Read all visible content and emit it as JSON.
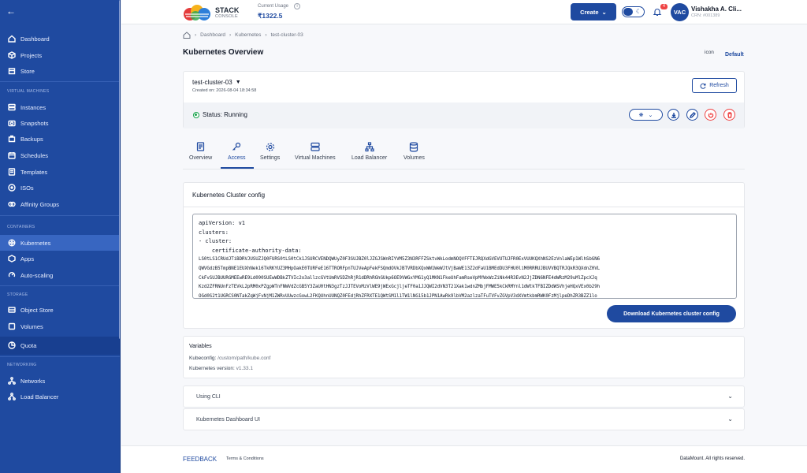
{
  "sidebar": {
    "back_icon": "arrow-left-icon",
    "items_top": [
      {
        "label": "Dashboard",
        "icon": "home-icon"
      },
      {
        "label": "Projects",
        "icon": "cube-icon"
      },
      {
        "label": "Store",
        "icon": "store-icon"
      }
    ],
    "section_vm": "VIRTUAL MACHINES",
    "items_vm": [
      {
        "label": "Instances",
        "icon": "server-icon"
      },
      {
        "label": "Snapshots",
        "icon": "snapshot-icon"
      },
      {
        "label": "Backups",
        "icon": "backup-icon"
      },
      {
        "label": "Schedules",
        "icon": "calendar-icon"
      },
      {
        "label": "Templates",
        "icon": "template-icon"
      },
      {
        "label": "ISOs",
        "icon": "disc-icon"
      },
      {
        "label": "Affinity Groups",
        "icon": "group-icon"
      }
    ],
    "section_containers": "CONTAINERS",
    "items_containers": [
      {
        "label": "Kubernetes",
        "icon": "kubernetes-icon",
        "active": true
      },
      {
        "label": "Apps",
        "icon": "apps-icon"
      },
      {
        "label": "Auto-scaling",
        "icon": "autoscale-icon"
      }
    ],
    "section_storage": "STORAGE",
    "items_storage": [
      {
        "label": "Object Store",
        "icon": "object-store-icon"
      },
      {
        "label": "Volumes",
        "icon": "volumes-icon"
      }
    ],
    "quota": {
      "label": "Quota",
      "icon": "quota-icon"
    },
    "section_networking": "NETWORKING",
    "items_networking": [
      {
        "label": "Networks",
        "icon": "network-icon"
      },
      {
        "label": "Load Balancer",
        "icon": "load-balancer-icon"
      }
    ]
  },
  "header": {
    "logo_text": "STACK",
    "logo_sub": "CONSOLE",
    "usage_label": "Current Usage",
    "usage_value": "₹1322.5",
    "create_label": "Create",
    "notification_count": "4",
    "avatar_initials": "VAC",
    "user_name": "Vishakha A. Cli...",
    "user_crn": "CRN: #001389"
  },
  "breadcrumb": {
    "items": [
      "Dashboard",
      "Kubernetes",
      "test-cluster-03"
    ]
  },
  "page": {
    "title": "Kubernetes Overview",
    "default_label": "Default",
    "broken_icon_alt": "icon"
  },
  "cluster": {
    "name": "test-cluster-03",
    "created": "Created on: 2026-08-04 18:34:58",
    "refresh_label": "Refresh",
    "status": "Status: Running",
    "status_color": "#16a34a"
  },
  "tabs": [
    {
      "label": "Overview",
      "icon": "overview-icon"
    },
    {
      "label": "Access",
      "icon": "key-icon",
      "active": true
    },
    {
      "label": "Settings",
      "icon": "gear-icon"
    },
    {
      "label": "Virtual Machines",
      "icon": "server-icon"
    },
    {
      "label": "Load Balancer",
      "icon": "load-balancer-icon"
    },
    {
      "label": "Volumes",
      "icon": "database-icon"
    }
  ],
  "config": {
    "title": "Kubernetes Cluster config",
    "lines": [
      "apiVersion: v1",
      "clusters:",
      "- cluster:",
      "    certificate-authority-data:"
    ],
    "data_lines": [
      "LS0tLS1CRUdJTiBDRVJUSUZJQ0FURS0tLS0tCk1JSURCVENDQWUyZ0F3SUJBZ0lJZGJSWnRIYVM5Z3N3RFFZSktvWkLodmNOQVFFTEJRQXdGVEVUTUJFR0ExVUUKQXhNS2EzVnlaWEp1WlhSbGN6",
      "QWVGdzB5TmpBNE1EUXhNek16TkRKYUZ3MHpOakE0TURFeE16TTRORFpnTUJVeApFekFSQmdOVkJBTVRDbXQxWW1WeWJtVjBaWE13Z2dFaU1BMEdDU3FHU0liM0RRRUJBUVVBQTRJQkR3QXdnZ0VL",
      "CkFvSUJBUURGMEEwRE9Ld090SUEwWDBkZTVIc2o3allzcGVtUmRVSDZhRjR1dDRhRGhGUkp6OE9VWGxYMG1yQ1MKN1FkeUhFamRseVpMYWxWzZiNk44R3EvN2JjZDN6NFE4dWRzM29uMlZpcXJq",
      "Kzd2ZFRNUnFzTEVkL2pRM0xPZgpWTnFNWVdZcGB5Y3ZaU0tHN3gzTzJJTEVoMzVlWE9jWExGcjljeTF0a1JJQWI2dVN3T21Xak1wdnZMbjFMWE5kCkRMYnl1dWtkTFBIZDdWSVhjeHQxVEx0b29h",
      "OGd0S2t1UGRCS0NTakZqWjFvNjM1ZWRvUUwzcGowL2FKQUhnUUNQZ0FEdjRhZFRXTE1QWtSM1l1TW1lNG15b1JPN1AwRk9lbVM2azlzaTFuTVFvZGVpV3dXVmtkbmRWK0FzMjlpeDhZR3BZZ1lo"
    ],
    "download_label": "Download Kubernetes cluster config"
  },
  "variables": {
    "title": "Variables",
    "kubeconfig_label": "Kubeconfig:",
    "kubeconfig_value": "/custom/path/kube.conf",
    "version_label": "Kubernetes version:",
    "version_value": "v1.33.1"
  },
  "accordions": [
    {
      "label": "Using CLI"
    },
    {
      "label": "Kubernetes Dashboard UI"
    }
  ],
  "footer": {
    "feedback": "FEEDBACK",
    "terms": "Terms & Conditions",
    "copyright": "DataMount. All rights reserved."
  },
  "colors": {
    "brand": "#1f4aa0",
    "sidebar": "#1f4aa0",
    "danger": "#ef4444",
    "success": "#16a34a"
  }
}
